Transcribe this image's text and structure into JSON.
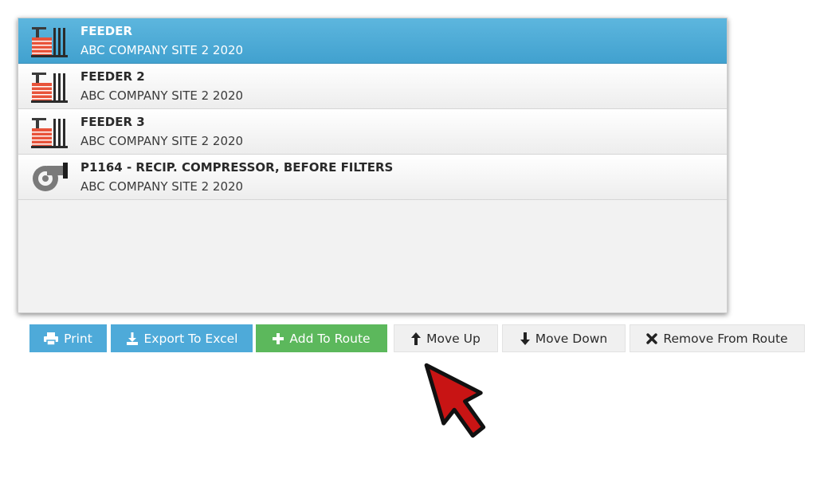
{
  "list": {
    "items": [
      {
        "title": "FEEDER",
        "subtitle": "ABC COMPANY SITE 2 2020",
        "icon": "factory-icon",
        "selected": true
      },
      {
        "title": "FEEDER 2",
        "subtitle": "ABC COMPANY SITE 2 2020",
        "icon": "factory-icon",
        "selected": false
      },
      {
        "title": "FEEDER 3",
        "subtitle": "ABC COMPANY SITE 2 2020",
        "icon": "factory-icon",
        "selected": false
      },
      {
        "title": "P1164 - RECIP. COMPRESSOR, BEFORE FILTERS",
        "subtitle": "ABC COMPANY SITE 2 2020",
        "icon": "compressor-icon",
        "selected": false
      }
    ]
  },
  "toolbar": {
    "print_label": "Print",
    "export_label": "Export To Excel",
    "add_label": "Add To Route",
    "move_up_label": "Move Up",
    "move_down_label": "Move Down",
    "remove_label": "Remove From Route"
  },
  "colors": {
    "selected_row": "#4aa9d6",
    "primary_button": "#4eaad9",
    "success_button": "#5cb85c",
    "callout_arrow": "#c81414"
  }
}
